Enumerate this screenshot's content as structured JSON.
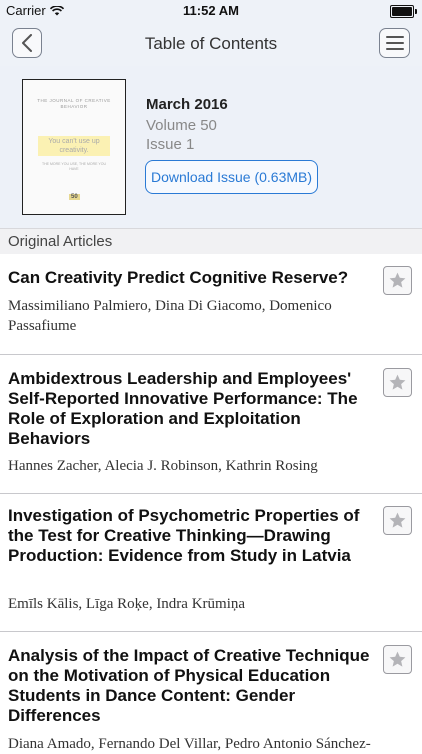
{
  "status_bar": {
    "carrier": "Carrier",
    "time": "11:52 AM"
  },
  "nav": {
    "title": "Table of Contents"
  },
  "issue": {
    "date": "March 2016",
    "volume": "Volume 50",
    "issue": "Issue 1",
    "download_label": "Download Issue (0.63MB)",
    "cover": {
      "journal_name": "THE JOURNAL OF CREATIVE BEHAVIOR",
      "headline": "You can't use up creativity.",
      "tagline": "THE MORE YOU USE, THE MORE YOU HAVE",
      "volume_badge": "50"
    }
  },
  "section": {
    "title": "Original Articles"
  },
  "articles": [
    {
      "title": "Can Creativity Predict Cognitive Reserve?",
      "authors": "Massimiliano Palmiero, Dina Di Giacomo, Domenico Passafiume"
    },
    {
      "title": "Ambidextrous Leadership and Employees' Self-Reported Innovative Performance: The Role of Exploration and Exploitation Behaviors",
      "authors": "Hannes Zacher, Alecia J. Robinson, Kathrin Rosing"
    },
    {
      "title": "Investigation of Psychometric Properties of the Test for Creative Thinking—Drawing Production: Evidence from Study in Latvia",
      "authors": "Emīls Kālis, Līga Roķe, Indra Krūmiņa"
    },
    {
      "title": "Analysis of the Impact of Creative Technique on the Motivation of Physical Education Students in Dance Content: Gender Differences",
      "authors": "Diana Amado, Fernando Del Villar, Pedro Antonio Sánchez-"
    }
  ],
  "colors": {
    "accent": "#2a7ad5",
    "header_bg": "#edf1f8"
  }
}
